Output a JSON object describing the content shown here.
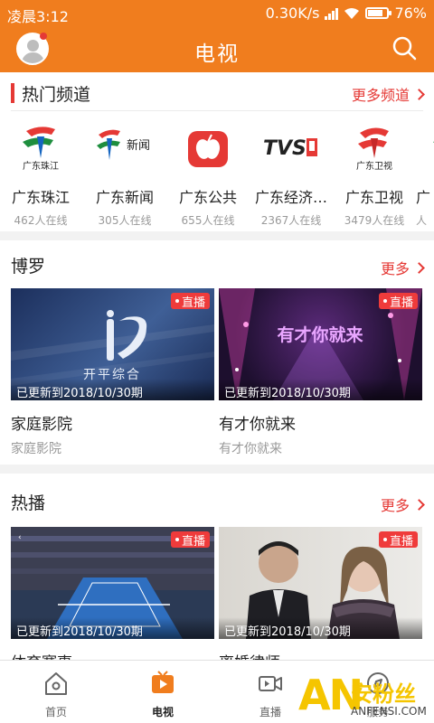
{
  "status_bar": {
    "time": "凌晨3:12",
    "network_speed": "0.30K/s",
    "battery": "76%"
  },
  "header": {
    "title": "电视"
  },
  "hot_channels": {
    "title": "热门频道",
    "more": "更多频道",
    "items": [
      {
        "name": "广东珠江",
        "viewers": "462人在线",
        "logo_text": "广东珠江"
      },
      {
        "name": "广东新闻",
        "viewers": "305人在线",
        "logo_text": "新闻"
      },
      {
        "name": "广东公共",
        "viewers": "655人在线",
        "logo_text": ""
      },
      {
        "name": "广东经济…",
        "viewers": "2367人在线",
        "logo_text": "TVS"
      },
      {
        "name": "广东卫视",
        "viewers": "3479人在线",
        "logo_text": "广东卫视"
      },
      {
        "name": "广",
        "viewers": "人",
        "logo_text": ""
      }
    ]
  },
  "sections": [
    {
      "title": "博罗",
      "more": "更多",
      "cards": [
        {
          "title": "家庭影院",
          "subtitle": "家庭影院",
          "update": "已更新到2018/10/30期",
          "live": "直播",
          "thumb_text": "开平综合"
        },
        {
          "title": "有才你就来",
          "subtitle": "有才你就来",
          "update": "已更新到2018/10/30期",
          "live": "直播",
          "thumb_text": "有才你就来"
        }
      ]
    },
    {
      "title": "热播",
      "more": "更多",
      "cards": [
        {
          "title": "体育赛事",
          "subtitle": "",
          "update": "已更新到2018/10/30期",
          "live": "直播",
          "thumb_text": ""
        },
        {
          "title": "离婚律师",
          "subtitle": "",
          "update": "已更新到2018/10/30期",
          "live": "直播",
          "thumb_text": ""
        }
      ]
    }
  ],
  "tabbar": {
    "items": [
      {
        "label": "首页"
      },
      {
        "label": "电视"
      },
      {
        "label": "直播"
      },
      {
        "label": "服务"
      }
    ]
  },
  "watermark": {
    "brand": "AN",
    "name": "安粉丝",
    "url": "ANFENSI.COM"
  },
  "colors": {
    "brand_orange": "#f07d1e",
    "accent_red": "#e53935",
    "watermark_yellow": "#f5c500"
  }
}
